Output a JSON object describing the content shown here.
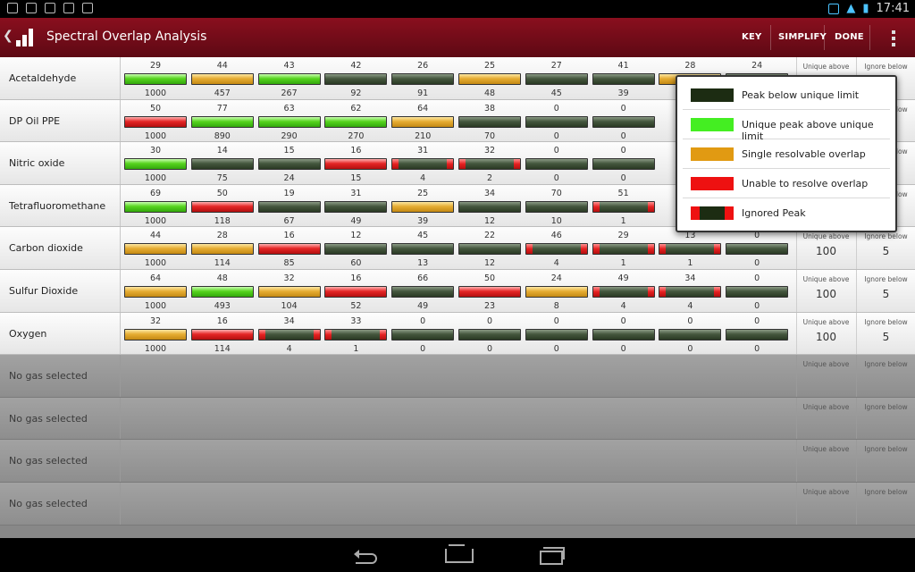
{
  "status_bar": {
    "time": "17:41"
  },
  "action_bar": {
    "title": "Spectral Overlap Analysis",
    "actions": {
      "key": "KEY",
      "simplify": "SIMPLIFY",
      "done": "DONE"
    }
  },
  "limit_labels": {
    "unique_above": "Unique above",
    "ignore_below": "Ignore below"
  },
  "gases": [
    {
      "name": "Acetaldehyde",
      "unique_above": "",
      "ignore_below": "",
      "peaks": [
        {
          "top": "29",
          "bottom": "1000",
          "color": "green"
        },
        {
          "top": "44",
          "bottom": "457",
          "color": "yellow"
        },
        {
          "top": "43",
          "bottom": "267",
          "color": "green"
        },
        {
          "top": "42",
          "bottom": "92",
          "color": "dark"
        },
        {
          "top": "26",
          "bottom": "91",
          "color": "dark"
        },
        {
          "top": "25",
          "bottom": "48",
          "color": "yellow"
        },
        {
          "top": "27",
          "bottom": "45",
          "color": "dark"
        },
        {
          "top": "41",
          "bottom": "39",
          "color": "dark"
        },
        {
          "top": "28",
          "bottom": "",
          "color": "yellow"
        },
        {
          "top": "24",
          "bottom": "",
          "color": "dark"
        }
      ]
    },
    {
      "name": "DP Oil PPE",
      "unique_above": "",
      "ignore_below": "",
      "peaks": [
        {
          "top": "50",
          "bottom": "1000",
          "color": "red"
        },
        {
          "top": "77",
          "bottom": "890",
          "color": "green"
        },
        {
          "top": "63",
          "bottom": "290",
          "color": "green"
        },
        {
          "top": "62",
          "bottom": "270",
          "color": "green"
        },
        {
          "top": "64",
          "bottom": "210",
          "color": "yellow"
        },
        {
          "top": "38",
          "bottom": "70",
          "color": "dark"
        },
        {
          "top": "0",
          "bottom": "0",
          "color": "dark"
        },
        {
          "top": "0",
          "bottom": "0",
          "color": "dark"
        }
      ]
    },
    {
      "name": "Nitric oxide",
      "unique_above": "",
      "ignore_below": "",
      "peaks": [
        {
          "top": "30",
          "bottom": "1000",
          "color": "green"
        },
        {
          "top": "14",
          "bottom": "75",
          "color": "dark"
        },
        {
          "top": "15",
          "bottom": "24",
          "color": "dark"
        },
        {
          "top": "16",
          "bottom": "15",
          "color": "red"
        },
        {
          "top": "31",
          "bottom": "4",
          "color": "ignored"
        },
        {
          "top": "32",
          "bottom": "2",
          "color": "ignored"
        },
        {
          "top": "0",
          "bottom": "0",
          "color": "dark"
        },
        {
          "top": "0",
          "bottom": "0",
          "color": "dark"
        }
      ]
    },
    {
      "name": "Tetrafluoromethane",
      "unique_above": "",
      "ignore_below": "",
      "peaks": [
        {
          "top": "69",
          "bottom": "1000",
          "color": "green"
        },
        {
          "top": "50",
          "bottom": "118",
          "color": "red"
        },
        {
          "top": "19",
          "bottom": "67",
          "color": "dark"
        },
        {
          "top": "31",
          "bottom": "49",
          "color": "dark"
        },
        {
          "top": "25",
          "bottom": "39",
          "color": "yellow"
        },
        {
          "top": "34",
          "bottom": "12",
          "color": "dark"
        },
        {
          "top": "70",
          "bottom": "10",
          "color": "dark"
        },
        {
          "top": "51",
          "bottom": "1",
          "color": "ignored"
        }
      ]
    },
    {
      "name": "Carbon dioxide",
      "unique_above": "100",
      "ignore_below": "5",
      "peaks": [
        {
          "top": "44",
          "bottom": "1000",
          "color": "yellow"
        },
        {
          "top": "28",
          "bottom": "114",
          "color": "yellow"
        },
        {
          "top": "16",
          "bottom": "85",
          "color": "red"
        },
        {
          "top": "12",
          "bottom": "60",
          "color": "dark"
        },
        {
          "top": "45",
          "bottom": "13",
          "color": "dark"
        },
        {
          "top": "22",
          "bottom": "12",
          "color": "dark"
        },
        {
          "top": "46",
          "bottom": "4",
          "color": "ignored"
        },
        {
          "top": "29",
          "bottom": "1",
          "color": "ignored"
        },
        {
          "top": "13",
          "bottom": "1",
          "color": "ignored"
        },
        {
          "top": "0",
          "bottom": "0",
          "color": "dark"
        }
      ]
    },
    {
      "name": "Sulfur Dioxide",
      "unique_above": "100",
      "ignore_below": "5",
      "peaks": [
        {
          "top": "64",
          "bottom": "1000",
          "color": "yellow"
        },
        {
          "top": "48",
          "bottom": "493",
          "color": "green"
        },
        {
          "top": "32",
          "bottom": "104",
          "color": "yellow"
        },
        {
          "top": "16",
          "bottom": "52",
          "color": "red"
        },
        {
          "top": "66",
          "bottom": "49",
          "color": "dark"
        },
        {
          "top": "50",
          "bottom": "23",
          "color": "red"
        },
        {
          "top": "24",
          "bottom": "8",
          "color": "yellow"
        },
        {
          "top": "49",
          "bottom": "4",
          "color": "ignored"
        },
        {
          "top": "34",
          "bottom": "4",
          "color": "ignored"
        },
        {
          "top": "0",
          "bottom": "0",
          "color": "dark"
        }
      ]
    },
    {
      "name": "Oxygen",
      "unique_above": "100",
      "ignore_below": "5",
      "peaks": [
        {
          "top": "32",
          "bottom": "1000",
          "color": "yellow"
        },
        {
          "top": "16",
          "bottom": "114",
          "color": "red"
        },
        {
          "top": "34",
          "bottom": "4",
          "color": "ignored"
        },
        {
          "top": "33",
          "bottom": "1",
          "color": "ignored"
        },
        {
          "top": "0",
          "bottom": "0",
          "color": "dark"
        },
        {
          "top": "0",
          "bottom": "0",
          "color": "dark"
        },
        {
          "top": "0",
          "bottom": "0",
          "color": "dark"
        },
        {
          "top": "0",
          "bottom": "0",
          "color": "dark"
        },
        {
          "top": "0",
          "bottom": "0",
          "color": "dark"
        },
        {
          "top": "0",
          "bottom": "0",
          "color": "dark"
        }
      ]
    }
  ],
  "empty_rows": [
    {
      "name": "No gas selected"
    },
    {
      "name": "No gas selected"
    },
    {
      "name": "No gas selected"
    },
    {
      "name": "No gas selected"
    }
  ],
  "key_popup": {
    "items": [
      {
        "label": "Peak below unique limit",
        "swatch": "dark",
        "color": "#1c2c12"
      },
      {
        "label": "Unique peak above unique limit",
        "swatch": "green",
        "color": "#44ee22"
      },
      {
        "label": "Single resolvable overlap",
        "swatch": "yellow",
        "color": "#e19a12"
      },
      {
        "label": "Unable to resolve overlap",
        "swatch": "red",
        "color": "#ee1111"
      },
      {
        "label": "Ignored Peak",
        "swatch": "ignored",
        "color": "#1c2c12"
      }
    ]
  },
  "icons": [
    "app-chart-icon",
    "overflow-menu-icon",
    "back-nav-icon",
    "home-nav-icon",
    "recent-apps-icon",
    "wifi-icon",
    "battery-icon"
  ]
}
